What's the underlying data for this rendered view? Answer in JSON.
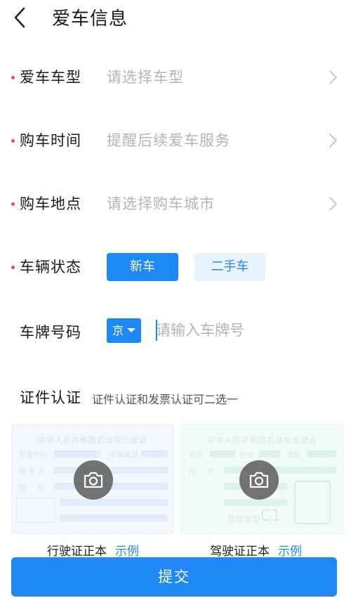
{
  "nav": {
    "title": "爱车信息",
    "back_icon": "back-arrow-icon"
  },
  "form": {
    "model": {
      "label": "爱车车型",
      "placeholder": "请选择车型",
      "required": true
    },
    "purchase_time": {
      "label": "购车时间",
      "placeholder": "提醒后续爱车服务",
      "required": true
    },
    "purchase_place": {
      "label": "购车地点",
      "placeholder": "请选择购车城市",
      "required": true
    },
    "vehicle_status": {
      "label": "车辆状态",
      "required": true,
      "options": [
        "新车",
        "二手车"
      ],
      "selected": "新车"
    },
    "plate": {
      "label": "车牌号码",
      "province": "京",
      "placeholder": "请输入车牌号",
      "value": ""
    }
  },
  "certification": {
    "title": "证件认证",
    "hint": "证件认证和发票认证可二选一",
    "cards": [
      {
        "doc_title": "中华人民共和国机动车行驶证",
        "caption": "行驶证正本",
        "example_link": "示例"
      },
      {
        "doc_title": "中华人民共和国机动车驾驶证",
        "caption": "驾驶证正本",
        "example_link": "示例"
      }
    ]
  },
  "submit_label": "提交",
  "colors": {
    "primary": "#1e88f5",
    "required_dot": "#f04a4a",
    "placeholder": "#b4b4b4"
  }
}
